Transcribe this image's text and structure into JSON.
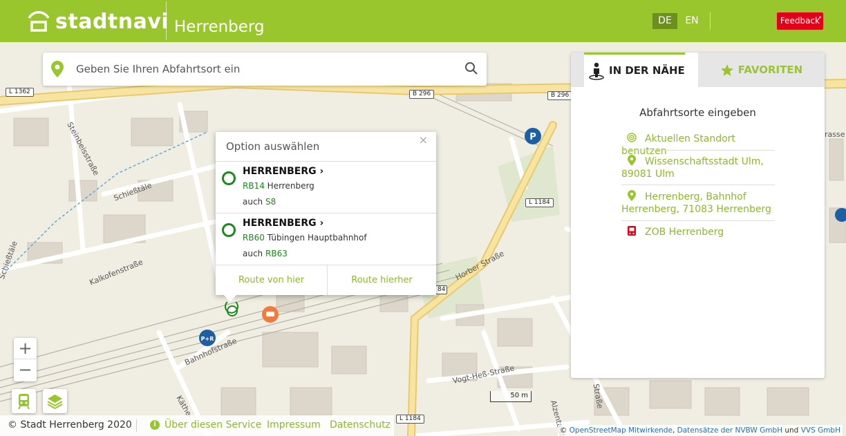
{
  "header": {
    "logo_text": "stadtnavi",
    "city": "Herrenberg",
    "lang_de": "DE",
    "lang_en": "EN",
    "feedback": "Feedback"
  },
  "search": {
    "placeholder": "Geben Sie Ihren Abfahrtsort ein"
  },
  "popup": {
    "title": "Option auswählen",
    "close": "×",
    "options": [
      {
        "name": "HERRENBERG ›",
        "route": "RB14",
        "destination": "Herrenberg",
        "also_label": "auch",
        "also_route": "S8"
      },
      {
        "name": "HERRENBERG ›",
        "route": "RB60",
        "destination": "Tübingen Hauptbahnhof",
        "also_label": "auch",
        "also_route": "RB63"
      }
    ],
    "route_from": "Route von hier",
    "route_to": "Route hierher"
  },
  "panel": {
    "tab_nearby": "IN DER NÄHE",
    "tab_favorites": "FAVORITEN",
    "heading": "Abfahrtsorte eingeben",
    "locations": [
      {
        "label": "Aktuellen Standort benutzen",
        "icon": "locate-icon"
      },
      {
        "label": "Wissenschaftsstadt Ulm, 89081 Ulm",
        "icon": "map-pin-icon"
      },
      {
        "label": "Herrenberg, Bahnhof Herrenberg, 71083 Herrenberg",
        "icon": "map-pin-icon"
      },
      {
        "label": "ZOB Herrenberg",
        "icon": "bus-stop-icon"
      }
    ]
  },
  "map": {
    "zoom_in": "+",
    "zoom_out": "−",
    "scale": "50 m",
    "road_labels": [
      "L 1362",
      "B 296",
      "B 296",
      "L 1184",
      "L 1184",
      "L 1184"
    ],
    "street_labels": [
      "Steinbeisstraße",
      "Schießtäle",
      "Kalkofenstraße",
      "Bahnhofstraße",
      "Horber Straße",
      "Vogt-Heß-Straße",
      "Alzentalstr.",
      "Straße",
      "Käthe-",
      "Schießtäle",
      "rasse"
    ]
  },
  "footer": {
    "copyright": "© Stadt Herrenberg 2020",
    "about": "Über diesen Service",
    "imprint": "Impressum",
    "privacy": "Datenschutz",
    "attribution_prefix": "©",
    "attribution_osm": "OpenStreetMap Mitwirkende",
    "attribution_comma": ",",
    "attribution_nvbw": "Datensätze der NVBW GmbH",
    "attribution_and": "und",
    "attribution_vvs": "VVS GmbH"
  },
  "colors": {
    "brand": "#9ac62d",
    "route_green": "#1a8a1a",
    "feedback_red": "#e2001a"
  }
}
